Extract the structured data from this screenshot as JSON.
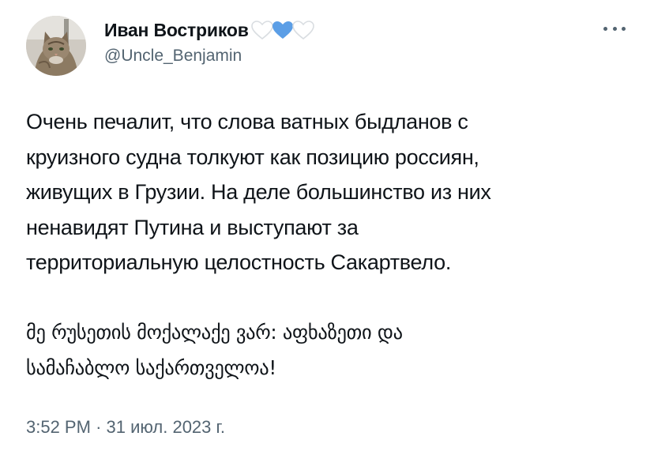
{
  "author": {
    "display_name": "Иван Востриков",
    "handle": "@Uncle_Benjamin",
    "avatar_icon": "cat-avatar",
    "badge_icons": [
      "white-heart-icon",
      "blue-heart-icon",
      "white-heart-icon"
    ]
  },
  "more_icon": "more-horizontal-icon",
  "tweet": {
    "lines": [
      "Очень печалит, что слова ватных быдланов с",
      "круизного судна толкуют как позицию россиян,",
      "живущих в Грузии. На деле большинство из них",
      "ненавидят Путина и выступают за",
      "территориальную целостность Сакартвело."
    ],
    "georgian_lines": [
      "მე რუსეთის მოქალაქე ვარ: აფხაზეთი და",
      "სამაჩაბლო საქართველოა!"
    ]
  },
  "meta": {
    "time": "3:52 PM",
    "separator": "·",
    "date": "31 июл. 2023 г."
  },
  "colors": {
    "text": "#0f1419",
    "secondary": "#536471",
    "blue_heart": "#5b9ee6",
    "white_heart_stroke": "#d9dde1"
  }
}
